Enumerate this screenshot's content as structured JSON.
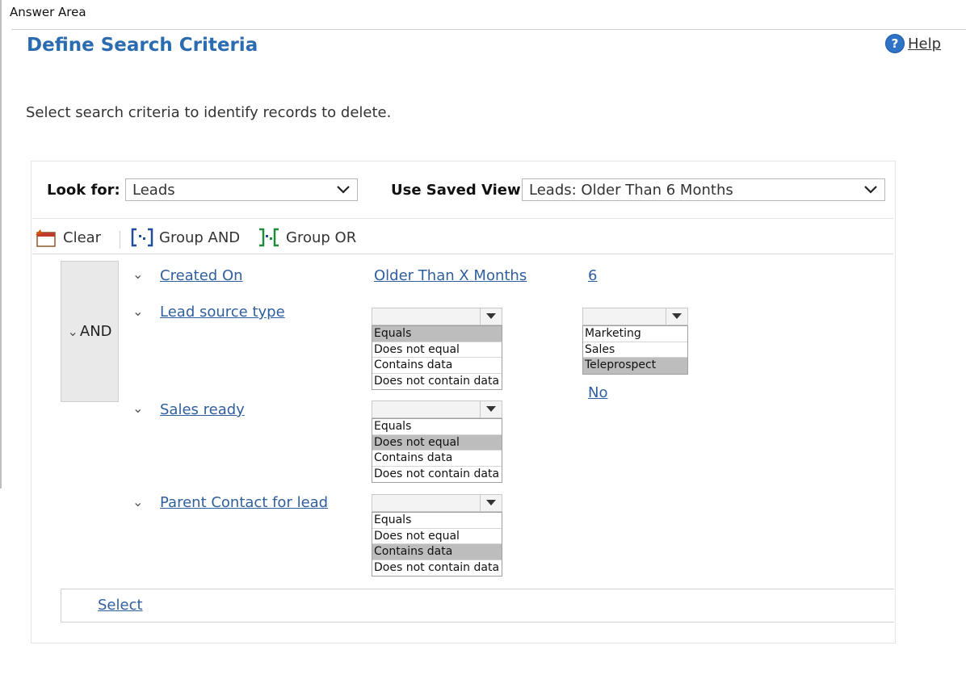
{
  "answer_area": "Answer Area",
  "title": "Define Search Criteria",
  "help": {
    "label": "Help",
    "icon": "help-icon",
    "color": "#2f73c7"
  },
  "instructions": "Select search criteria to identify records to delete.",
  "look_for": {
    "label": "Look for:",
    "value": "Leads"
  },
  "saved_view": {
    "label": "Use Saved View:",
    "value": "Leads: Older Than 6 Months"
  },
  "toolbar": {
    "clear": "Clear",
    "group_and": "Group AND",
    "group_or": "Group OR"
  },
  "group": {
    "operator": "AND"
  },
  "conditions": [
    {
      "field": "Created On",
      "operator": "Older Than X Months",
      "value": "6"
    },
    {
      "field": "Lead source type",
      "operators": [
        "Equals",
        "Does not equal",
        "Contains data",
        "Does not contain data"
      ],
      "selected_operator": "Equals",
      "values": [
        "Marketing",
        "Sales",
        "Teleprospect"
      ],
      "selected_value": "Teleprospect"
    },
    {
      "field": "Sales ready",
      "operators": [
        "Equals",
        "Does not equal",
        "Contains data",
        "Does not contain data"
      ],
      "selected_operator": "Does not equal",
      "value": "No"
    },
    {
      "field": "Parent Contact for lead",
      "operators": [
        "Equals",
        "Does not equal",
        "Contains data",
        "Does not contain data"
      ],
      "selected_operator": "Contains data"
    }
  ],
  "select_link": "Select",
  "colors": {
    "title": "#2b6cb0",
    "link": "#2f5f9e",
    "selected_option": "#bdbdbd"
  }
}
